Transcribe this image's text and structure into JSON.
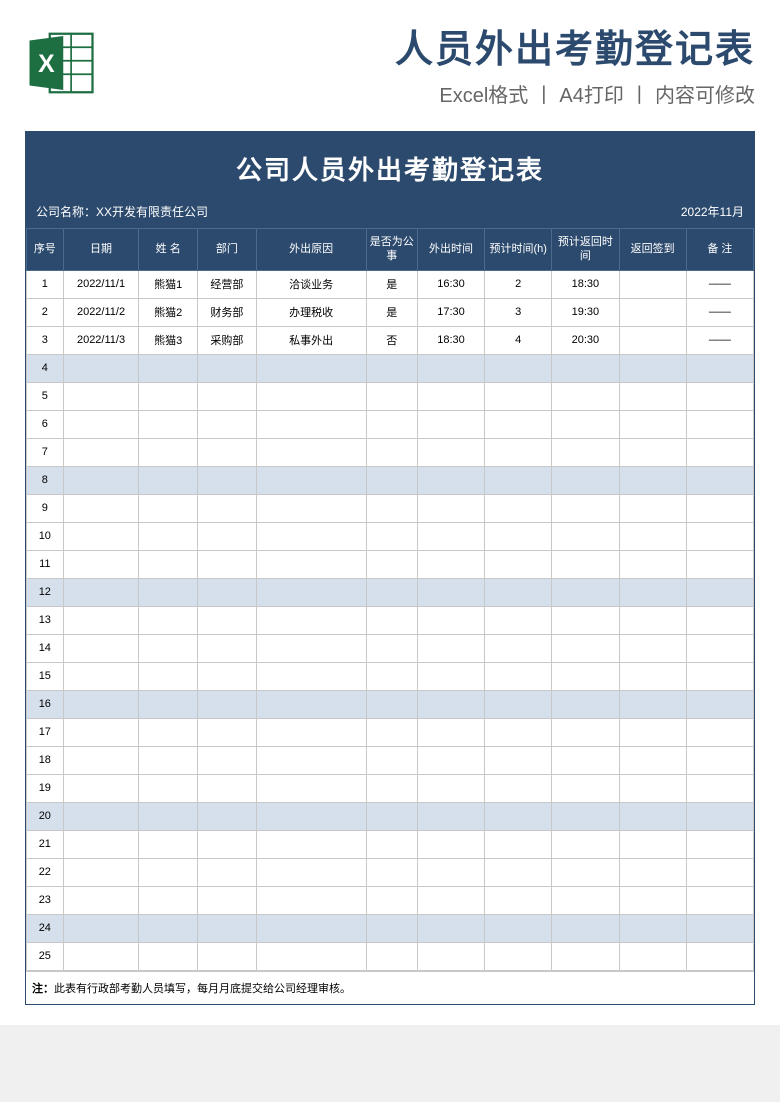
{
  "header": {
    "title": "人员外出考勤登记表",
    "subtitle": "Excel格式 丨 A4打印 丨 内容可修改"
  },
  "sheet": {
    "title": "公司人员外出考勤登记表",
    "company_label": "公司名称：",
    "company_name": "XX开发有限责任公司",
    "period": "2022年11月"
  },
  "columns": {
    "seq": "序号",
    "date": "日期",
    "name": "姓 名",
    "dept": "部门",
    "reason": "外出原因",
    "biz": "是否为公事",
    "out": "外出时间",
    "est": "预计时间(h)",
    "ret": "预计返回时间",
    "sign": "返回签到",
    "note": "备 注"
  },
  "rows": [
    {
      "seq": "1",
      "date": "2022/11/1",
      "name": "熊猫1",
      "dept": "经营部",
      "reason": "洽谈业务",
      "biz": "是",
      "out": "16:30",
      "est": "2",
      "ret": "18:30",
      "sign": "",
      "note": "——"
    },
    {
      "seq": "2",
      "date": "2022/11/2",
      "name": "熊猫2",
      "dept": "财务部",
      "reason": "办理税收",
      "biz": "是",
      "out": "17:30",
      "est": "3",
      "ret": "19:30",
      "sign": "",
      "note": "——"
    },
    {
      "seq": "3",
      "date": "2022/11/3",
      "name": "熊猫3",
      "dept": "采购部",
      "reason": "私事外出",
      "biz": "否",
      "out": "18:30",
      "est": "4",
      "ret": "20:30",
      "sign": "",
      "note": "——"
    },
    {
      "seq": "4",
      "shaded": true
    },
    {
      "seq": "5"
    },
    {
      "seq": "6"
    },
    {
      "seq": "7"
    },
    {
      "seq": "8",
      "shaded": true
    },
    {
      "seq": "9"
    },
    {
      "seq": "10"
    },
    {
      "seq": "11"
    },
    {
      "seq": "12",
      "shaded": true
    },
    {
      "seq": "13"
    },
    {
      "seq": "14"
    },
    {
      "seq": "15"
    },
    {
      "seq": "16",
      "shaded": true
    },
    {
      "seq": "17"
    },
    {
      "seq": "18"
    },
    {
      "seq": "19"
    },
    {
      "seq": "20",
      "shaded": true
    },
    {
      "seq": "21"
    },
    {
      "seq": "22"
    },
    {
      "seq": "23"
    },
    {
      "seq": "24",
      "shaded": true
    },
    {
      "seq": "25"
    }
  ],
  "footer_label": "注：",
  "footer_note": "此表有行政部考勤人员填写，每月月底提交给公司经理审核。"
}
